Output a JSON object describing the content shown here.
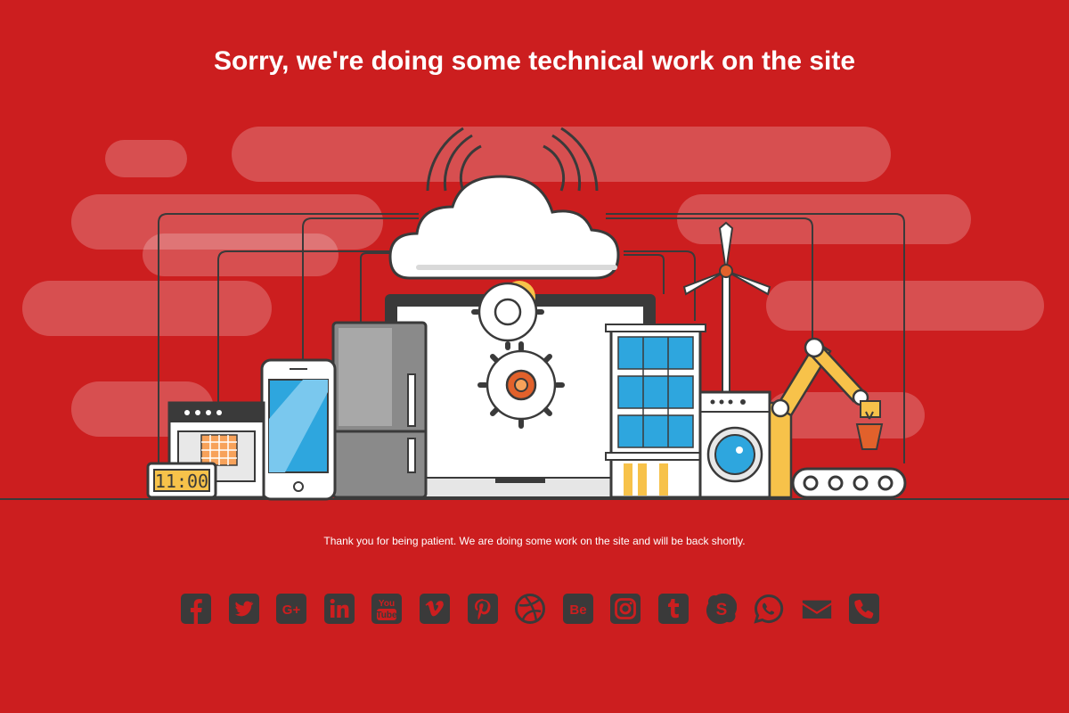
{
  "page": {
    "heading": "Sorry, we're doing some technical work on the site",
    "message": "Thank you for being patient. We are doing some work on the site and will be back shortly.",
    "background_color": "#cc1e1f",
    "icon_color": "#3a3a3a"
  },
  "illustration": {
    "clock_text": "11:00"
  },
  "social": {
    "icons": [
      {
        "name": "facebook-icon",
        "glyph": "f"
      },
      {
        "name": "twitter-icon",
        "glyph": ""
      },
      {
        "name": "google-plus-icon",
        "glyph": "G+"
      },
      {
        "name": "linkedin-icon",
        "glyph": "in"
      },
      {
        "name": "youtube-icon",
        "glyph": "You Tube"
      },
      {
        "name": "vimeo-icon",
        "glyph": "v"
      },
      {
        "name": "pinterest-icon",
        "glyph": "p"
      },
      {
        "name": "dribbble-icon",
        "glyph": ""
      },
      {
        "name": "behance-icon",
        "glyph": "Be"
      },
      {
        "name": "instagram-icon",
        "glyph": ""
      },
      {
        "name": "tumblr-icon",
        "glyph": "t"
      },
      {
        "name": "skype-icon",
        "glyph": "S"
      },
      {
        "name": "whatsapp-icon",
        "glyph": ""
      },
      {
        "name": "email-icon",
        "glyph": ""
      },
      {
        "name": "phone-icon",
        "glyph": ""
      }
    ]
  }
}
